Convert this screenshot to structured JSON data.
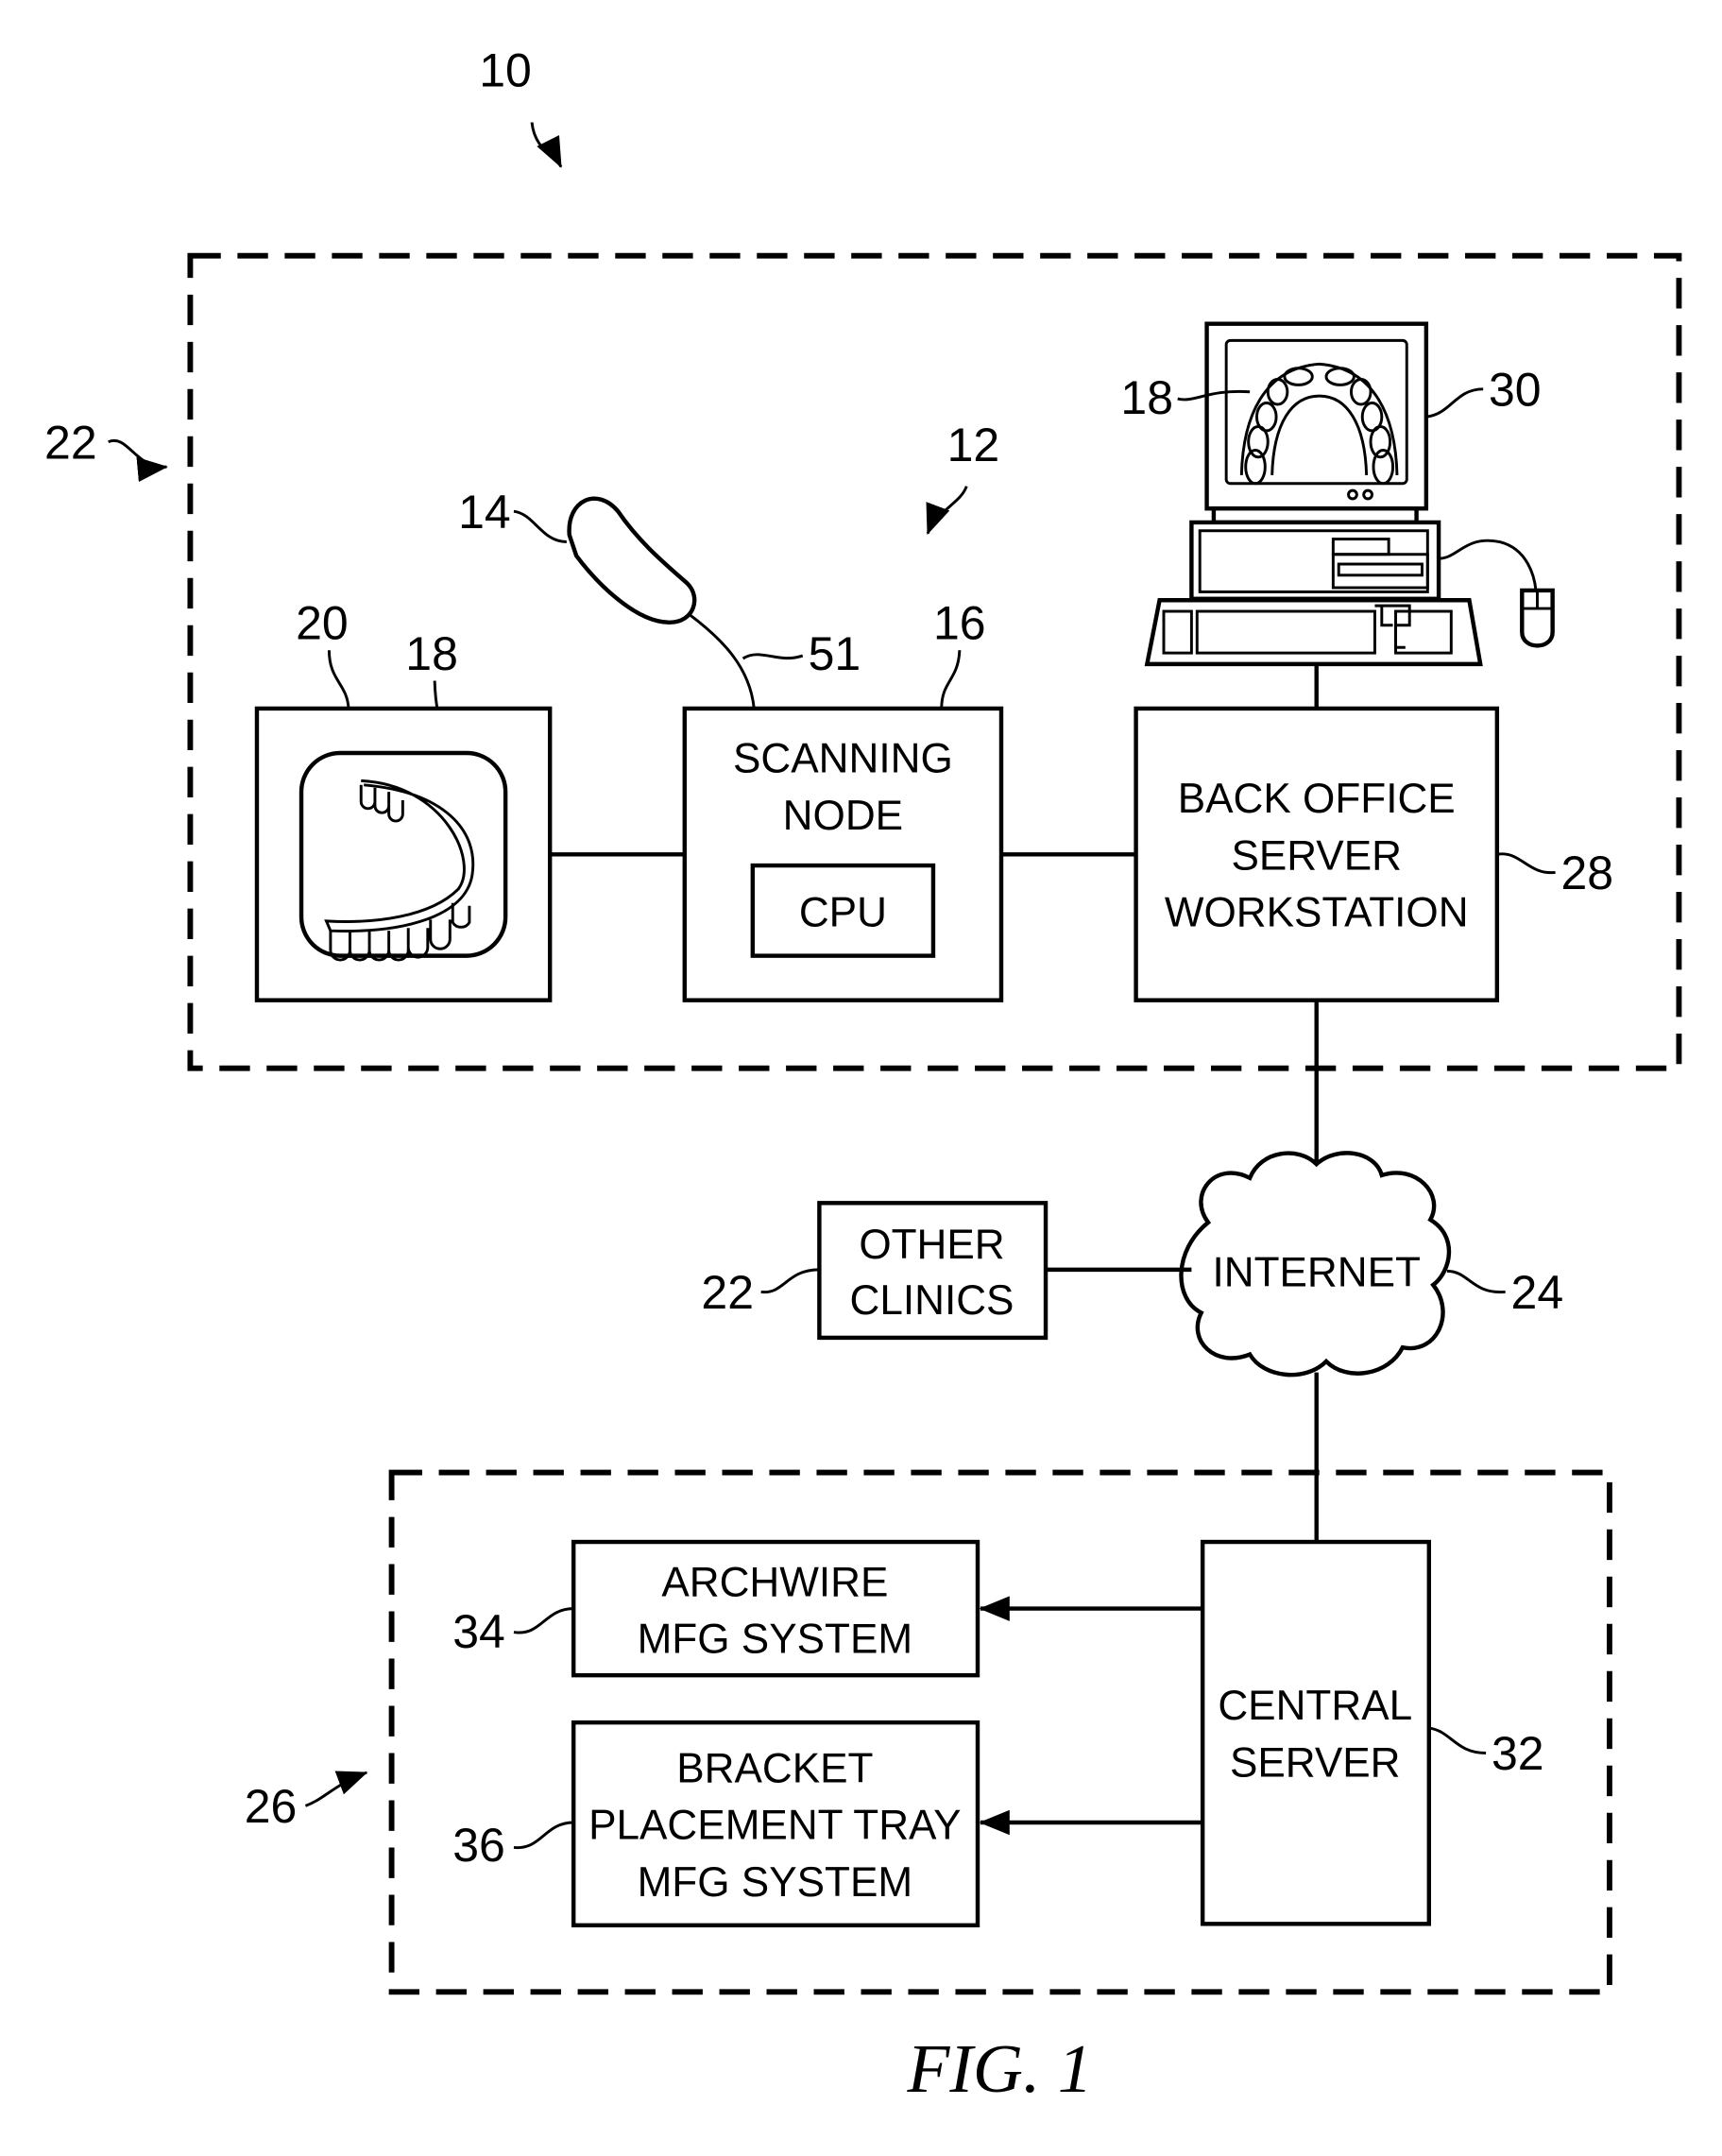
{
  "figure": {
    "caption": "FIG. 1",
    "system_ref": "10",
    "clinic_ref": "22",
    "clinic_section_ref": "12",
    "lower_section_ref": "26"
  },
  "components": {
    "scanner": {
      "ref": "14",
      "cable_ref": "51"
    },
    "model_box": {
      "ref": "20",
      "model_ref": "18"
    },
    "scanning_node": {
      "ref": "16",
      "lines": [
        "SCANNING",
        "NODE"
      ],
      "cpu_label": "CPU"
    },
    "back_office": {
      "ref": "28",
      "lines": [
        "BACK OFFICE",
        "SERVER",
        "WORKSTATION"
      ]
    },
    "monitor": {
      "ref": "30",
      "image_ref": "18"
    },
    "other_clinics": {
      "ref": "22",
      "lines": [
        "OTHER",
        "CLINICS"
      ]
    },
    "internet": {
      "ref": "24",
      "label": "INTERNET"
    },
    "central_server": {
      "ref": "32",
      "lines": [
        "CENTRAL",
        "SERVER"
      ]
    },
    "archwire": {
      "ref": "34",
      "lines": [
        "ARCHWIRE",
        "MFG SYSTEM"
      ]
    },
    "bracket": {
      "ref": "36",
      "lines": [
        "BRACKET",
        "PLACEMENT TRAY",
        "MFG SYSTEM"
      ]
    }
  }
}
